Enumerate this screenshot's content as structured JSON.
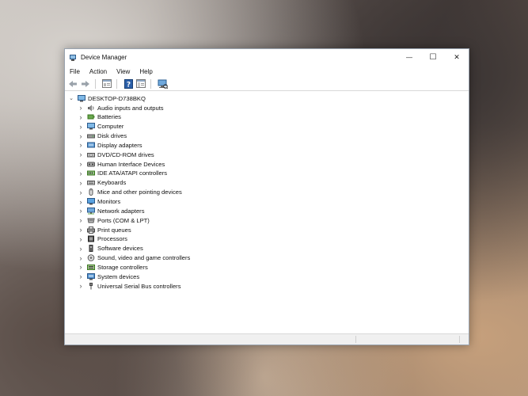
{
  "window": {
    "title": "Device Manager",
    "minimize_glyph": "—",
    "maximize_glyph": "☐",
    "close_glyph": "✕"
  },
  "menu": [
    "File",
    "Action",
    "View",
    "Help"
  ],
  "toolbar": {
    "buttons": [
      "back-icon",
      "forward-icon",
      "properties-icon",
      "help-icon",
      "show-hide-console-tree-icon",
      "scan-hardware-icon"
    ]
  },
  "tree": {
    "root": "DESKTOP-D738BKQ",
    "items": [
      {
        "label": "Audio inputs and outputs",
        "icon": "speaker-icon"
      },
      {
        "label": "Batteries",
        "icon": "battery-icon"
      },
      {
        "label": "Computer",
        "icon": "computer-icon"
      },
      {
        "label": "Disk drives",
        "icon": "disk-drive-icon"
      },
      {
        "label": "Display adapters",
        "icon": "display-adapter-icon"
      },
      {
        "label": "DVD/CD-ROM drives",
        "icon": "dvd-drive-icon"
      },
      {
        "label": "Human Interface Devices",
        "icon": "hid-icon"
      },
      {
        "label": "IDE ATA/ATAPI controllers",
        "icon": "ide-controller-icon"
      },
      {
        "label": "Keyboards",
        "icon": "keyboard-icon"
      },
      {
        "label": "Mice and other pointing devices",
        "icon": "mouse-icon"
      },
      {
        "label": "Monitors",
        "icon": "monitor-icon"
      },
      {
        "label": "Network adapters",
        "icon": "network-adapter-icon"
      },
      {
        "label": "Ports (COM & LPT)",
        "icon": "port-icon"
      },
      {
        "label": "Print queues",
        "icon": "printer-icon"
      },
      {
        "label": "Processors",
        "icon": "processor-icon"
      },
      {
        "label": "Software devices",
        "icon": "software-device-icon"
      },
      {
        "label": "Sound, video and game controllers",
        "icon": "sound-controller-icon"
      },
      {
        "label": "Storage controllers",
        "icon": "storage-controller-icon"
      },
      {
        "label": "System devices",
        "icon": "system-device-icon"
      },
      {
        "label": "Universal Serial Bus controllers",
        "icon": "usb-icon"
      }
    ]
  },
  "colors": {
    "accent": "#1e72c2",
    "title_bar": "#ffffff"
  }
}
